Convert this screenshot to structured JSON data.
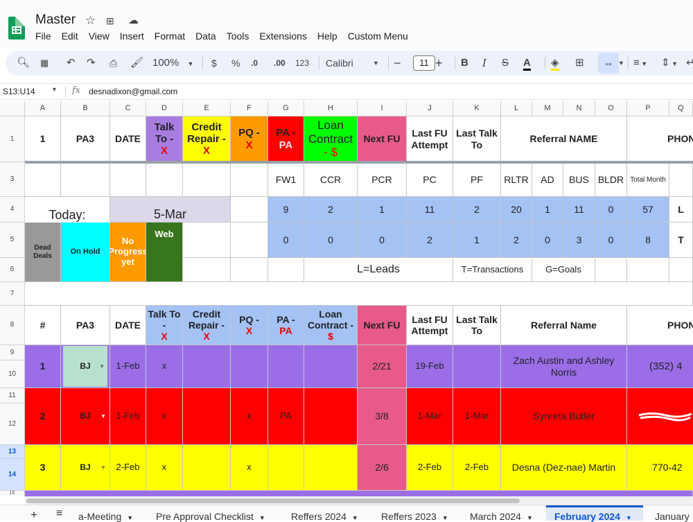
{
  "title": "Master",
  "menus": [
    "File",
    "Edit",
    "View",
    "Insert",
    "Format",
    "Data",
    "Tools",
    "Extensions",
    "Help",
    "Custom Menu"
  ],
  "toolbar": {
    "zoom": "100%",
    "currency": "$",
    "percent": "%",
    "dec_less": ".0",
    "dec_more": ".00",
    "number_fmt": "123",
    "font": "Calibri",
    "font_size": "11",
    "bold": "B",
    "italic": "I",
    "minus": "−",
    "plus": "+"
  },
  "namebox": "S13:U14",
  "formula": "desnadixon@gmail.com",
  "columns": [
    "A",
    "B",
    "C",
    "D",
    "E",
    "F",
    "G",
    "H",
    "I",
    "J",
    "K",
    "L",
    "M",
    "N",
    "O",
    "P",
    "Q"
  ],
  "rows": {
    "r1": "1",
    "r3": "3",
    "r4": "4",
    "r5": "5",
    "r6": "6",
    "r7": "7",
    "r8": "8",
    "r9": "9",
    "r10": "10",
    "r11": "11",
    "r12": "12",
    "r13": "13",
    "r14": "14",
    "r15": "15"
  },
  "header1": {
    "a": "1",
    "b": "PA3",
    "c": "DATE",
    "d_top": "Talk To -",
    "d_x": "X",
    "e_top": "Credit Repair -",
    "e_x": "X",
    "f_top": "PQ -",
    "f_x": "X",
    "g_top": "PA -",
    "g_x": "PA",
    "h_top": "Loan Contract",
    "h_x": "- $",
    "i": "Next FU",
    "j": "Last FU Attempt",
    "k": "Last Talk To",
    "l": "Referral NAME",
    "q": "PHON"
  },
  "stats": {
    "labels": [
      "FW1",
      "CCR",
      "PCR",
      "PC",
      "PF",
      "RLTR",
      "AD",
      "BUS",
      "BLDR",
      "Total Month"
    ],
    "leads": [
      "9",
      "2",
      "1",
      "11",
      "2",
      "20",
      "1",
      "11",
      "0",
      "57"
    ],
    "transactions": [
      "0",
      "0",
      "0",
      "2",
      "1",
      "2",
      "0",
      "3",
      "0",
      "8"
    ],
    "leads_key": "L",
    "trans_key": "T"
  },
  "today_label": "Today:",
  "today_value": "5-Mar",
  "legend": {
    "dead": "Dead Deals",
    "hold": "On Hold",
    "noprog": "No Progress yet",
    "web": "Web"
  },
  "notes": {
    "leads": "L=Leads",
    "trans": "T=Transactions",
    "goals": "G=Goals"
  },
  "header2": {
    "a": "#",
    "b": "PA3",
    "c": "DATE",
    "d_top": "Talk To -",
    "d_x": "X",
    "e_top": "Credit Repair -",
    "e_x": "X",
    "f_top": "PQ -",
    "f_x": "X",
    "g_top": "PA -",
    "g_x": "PA",
    "h_top": "Loan Contract -",
    "h_x": "$",
    "i": "Next FU",
    "j": "Last FU Attempt",
    "k": "Last Talk To",
    "l": "Referral Name",
    "q": "PHON"
  },
  "deals": [
    {
      "num": "1",
      "pa3": "BJ",
      "date": "1-Feb",
      "talk": "x",
      "pq": "",
      "pa": "",
      "next": "2/21",
      "last_fu": "19-Feb",
      "last_talk": "",
      "name": "Zach Austin and Ashley Norris",
      "phone": "(352) 4"
    },
    {
      "num": "2",
      "pa3": "BJ",
      "date": "1-Feb",
      "talk": "x",
      "pq": "x",
      "pa": "PA",
      "next": "3/8",
      "last_fu": "1-Mar",
      "last_talk": "1-Mar",
      "name": "Syreeta Butler",
      "phone": ""
    },
    {
      "num": "3",
      "pa3": "BJ",
      "date": "2-Feb",
      "talk": "x",
      "pq": "x",
      "pa": "",
      "next": "2/6",
      "last_fu": "2-Feb",
      "last_talk": "2-Feb",
      "name": "Desna (Dez-nae) Martin",
      "phone": "770-42"
    }
  ],
  "tabs": [
    "a-Meeting",
    "Pre Approval Checklist",
    "Reffers 2024",
    "Reffers 2023",
    "March 2024",
    "February 2024",
    "January"
  ],
  "colors": {
    "purple": "#a87de0",
    "yellow": "#ffff00",
    "orange": "#ff9900",
    "red": "#ff0000",
    "green": "#00ff00",
    "pink": "#e85a8a",
    "blue": "#a4c2f4",
    "lavender": "#dcd8ea",
    "gray": "#999999",
    "cyan": "#00ffff",
    "web_green": "#38761d",
    "mint": "#b7e1cd",
    "deal_purple": "#9b6ee8",
    "deal_red": "#ff0000",
    "deal_yellow": "#ffff00"
  }
}
